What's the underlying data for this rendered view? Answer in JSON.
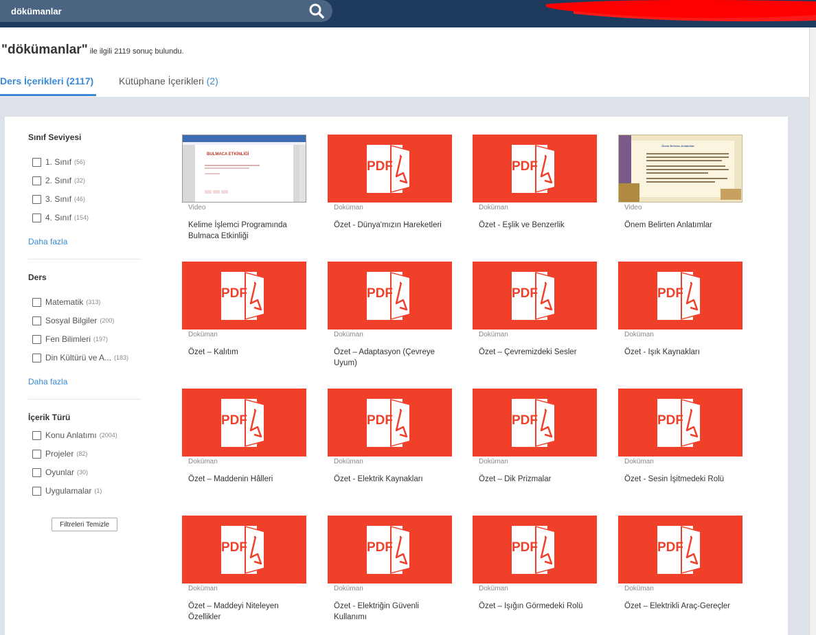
{
  "search": {
    "value": "dökümanlar",
    "icon": "search-icon"
  },
  "results": {
    "query": "\"dökümanlar\"",
    "summary": "ile ilgili 2119 sonuç bulundu."
  },
  "tabs": [
    {
      "label": "Ders İçerikleri",
      "count": "(2117)",
      "active": true
    },
    {
      "label": "Kütüphane İçerikleri",
      "count": "(2)",
      "active": false
    }
  ],
  "filters": {
    "grade": {
      "title": "Sınıf Seviyesi",
      "items": [
        {
          "label": "1. Sınıf",
          "count": "(56)"
        },
        {
          "label": "2. Sınıf",
          "count": "(32)"
        },
        {
          "label": "3. Sınıf",
          "count": "(46)"
        },
        {
          "label": "4. Sınıf",
          "count": "(154)"
        }
      ],
      "more": "Daha fazla"
    },
    "subject": {
      "title": "Ders",
      "items": [
        {
          "label": "Matematik",
          "count": "(313)"
        },
        {
          "label": "Sosyal Bilgiler",
          "count": "(200)"
        },
        {
          "label": "Fen Bilimleri",
          "count": "(197)"
        },
        {
          "label": "Din Kültürü ve A...",
          "count": "(183)"
        }
      ],
      "more": "Daha fazla"
    },
    "content_type": {
      "title": "İçerik Türü",
      "items": [
        {
          "label": "Konu Anlatımı",
          "count": "(2004)"
        },
        {
          "label": "Projeler",
          "count": "(82)"
        },
        {
          "label": "Oyunlar",
          "count": "(30)"
        },
        {
          "label": "Uygulamalar",
          "count": "(1)"
        }
      ]
    },
    "clear_label": "Filtreleri Temizle"
  },
  "thumbs": {
    "pdf_text": "PDF",
    "word_heading": "BULMACA ETKİNLİĞİ",
    "story_heading": "Önem Belirten Anlatımlar"
  },
  "cards": [
    {
      "type": "Video",
      "title": "Kelime İşlemci Programında Bulmaca Etkinliği",
      "thumb": "word"
    },
    {
      "type": "Doküman",
      "title": "Özet - Dünya'mızın Hareketleri",
      "thumb": "pdf"
    },
    {
      "type": "Doküman",
      "title": "Özet - Eşlik ve Benzerlik",
      "thumb": "pdf"
    },
    {
      "type": "Video",
      "title": "Önem Belirten Anlatımlar",
      "thumb": "story"
    },
    {
      "type": "Doküman",
      "title": "Özet – Kalıtım",
      "thumb": "pdf"
    },
    {
      "type": "Doküman",
      "title": "Özet – Adaptasyon (Çevreye Uyum)",
      "thumb": "pdf"
    },
    {
      "type": "Doküman",
      "title": "Özet – Çevremizdeki Sesler",
      "thumb": "pdf"
    },
    {
      "type": "Doküman",
      "title": "Özet - Işık Kaynakları",
      "thumb": "pdf"
    },
    {
      "type": "Doküman",
      "title": "Özet – Maddenin Hâlleri",
      "thumb": "pdf"
    },
    {
      "type": "Doküman",
      "title": "Özet - Elektrik Kaynakları",
      "thumb": "pdf"
    },
    {
      "type": "Doküman",
      "title": "Özet – Dik Prizmalar",
      "thumb": "pdf"
    },
    {
      "type": "Doküman",
      "title": "Özet - Sesin İşitmedeki Rolü",
      "thumb": "pdf"
    },
    {
      "type": "Doküman",
      "title": "Özet – Maddeyi Niteleyen Özellikler",
      "thumb": "pdf"
    },
    {
      "type": "Doküman",
      "title": "Özet - Elektriğin Güvenli Kullanımı",
      "thumb": "pdf"
    },
    {
      "type": "Doküman",
      "title": "Özet – Işığın Görmedeki Rolü",
      "thumb": "pdf"
    },
    {
      "type": "Doküman",
      "title": "Özet – Elektrikli Araç-Gereçler",
      "thumb": "pdf"
    }
  ],
  "colors": {
    "topbar": "#1e3b5e",
    "accent": "#3a8ad6",
    "pdf_red": "#f0402a",
    "redaction": "#ff0000"
  }
}
